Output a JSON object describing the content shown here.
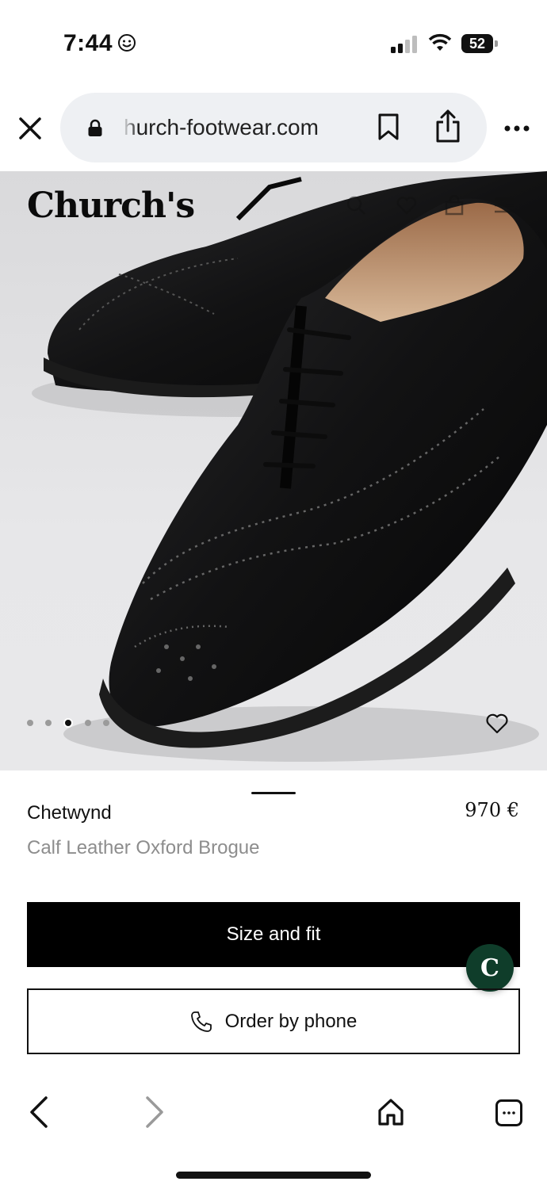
{
  "status_bar": {
    "time": "7:44",
    "battery": "52"
  },
  "browser": {
    "url": "hurch-footwear.com"
  },
  "site": {
    "logo": "Church's"
  },
  "gallery": {
    "dot_count": 5,
    "active_index": 2
  },
  "product": {
    "name": "Chetwynd",
    "price": "970 €",
    "subtitle": "Calf Leather Oxford Brogue"
  },
  "actions": {
    "size_and_fit": "Size and fit",
    "order_by_phone": "Order by phone"
  },
  "chat": {
    "label": "C"
  },
  "colors": {
    "chat_bg": "#0f3d2a",
    "primary_btn": "#000000"
  }
}
